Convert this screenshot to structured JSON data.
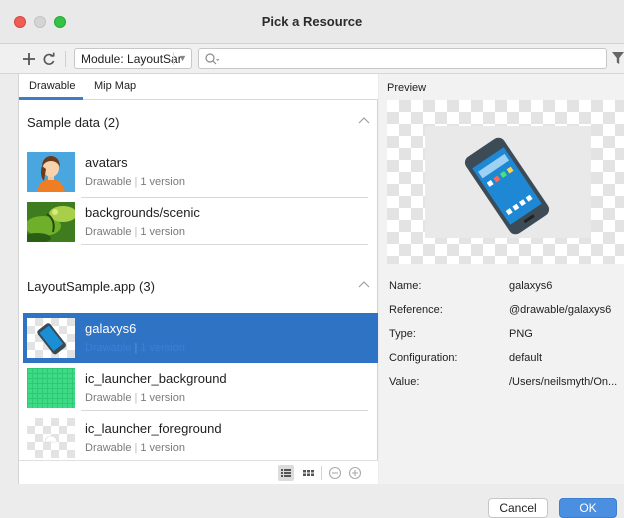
{
  "window": {
    "title": "Pick a Resource"
  },
  "toolbar": {
    "add_icon": "plus-icon",
    "refresh_icon": "refresh-icon",
    "module_select": "Module: LayoutSar",
    "search_value": "",
    "filter_icon": "filter-icon"
  },
  "tabs": [
    {
      "label": "Drawable",
      "active": true
    },
    {
      "label": "Mip Map",
      "active": false
    }
  ],
  "sections": [
    {
      "title": "Sample data (2)",
      "items": [
        {
          "name": "avatars",
          "type": "Drawable",
          "versions": "1 version"
        },
        {
          "name": "backgrounds/scenic",
          "type": "Drawable",
          "versions": "1 version"
        }
      ]
    },
    {
      "title": "LayoutSample.app (3)",
      "items": [
        {
          "name": "galaxys6",
          "type": "Drawable",
          "versions": "1 version",
          "selected": true
        },
        {
          "name": "ic_launcher_background",
          "type": "Drawable",
          "versions": "1 version"
        },
        {
          "name": "ic_launcher_foreground",
          "type": "Drawable",
          "versions": "1 version"
        }
      ]
    }
  ],
  "preview": {
    "label": "Preview",
    "properties": [
      {
        "key": "Name:",
        "value": "galaxys6"
      },
      {
        "key": "Reference:",
        "value": "@drawable/galaxys6"
      },
      {
        "key": "Type:",
        "value": "PNG"
      },
      {
        "key": "Configuration:",
        "value": "default"
      },
      {
        "key": "Value:",
        "value": "/Users/neilsmyth/On..."
      }
    ]
  },
  "buttons": {
    "cancel": "Cancel",
    "ok": "OK"
  },
  "colors": {
    "selection": "#2f73c4",
    "accent": "#4a8fe0",
    "tab_indicator": "#3f7dcc"
  }
}
